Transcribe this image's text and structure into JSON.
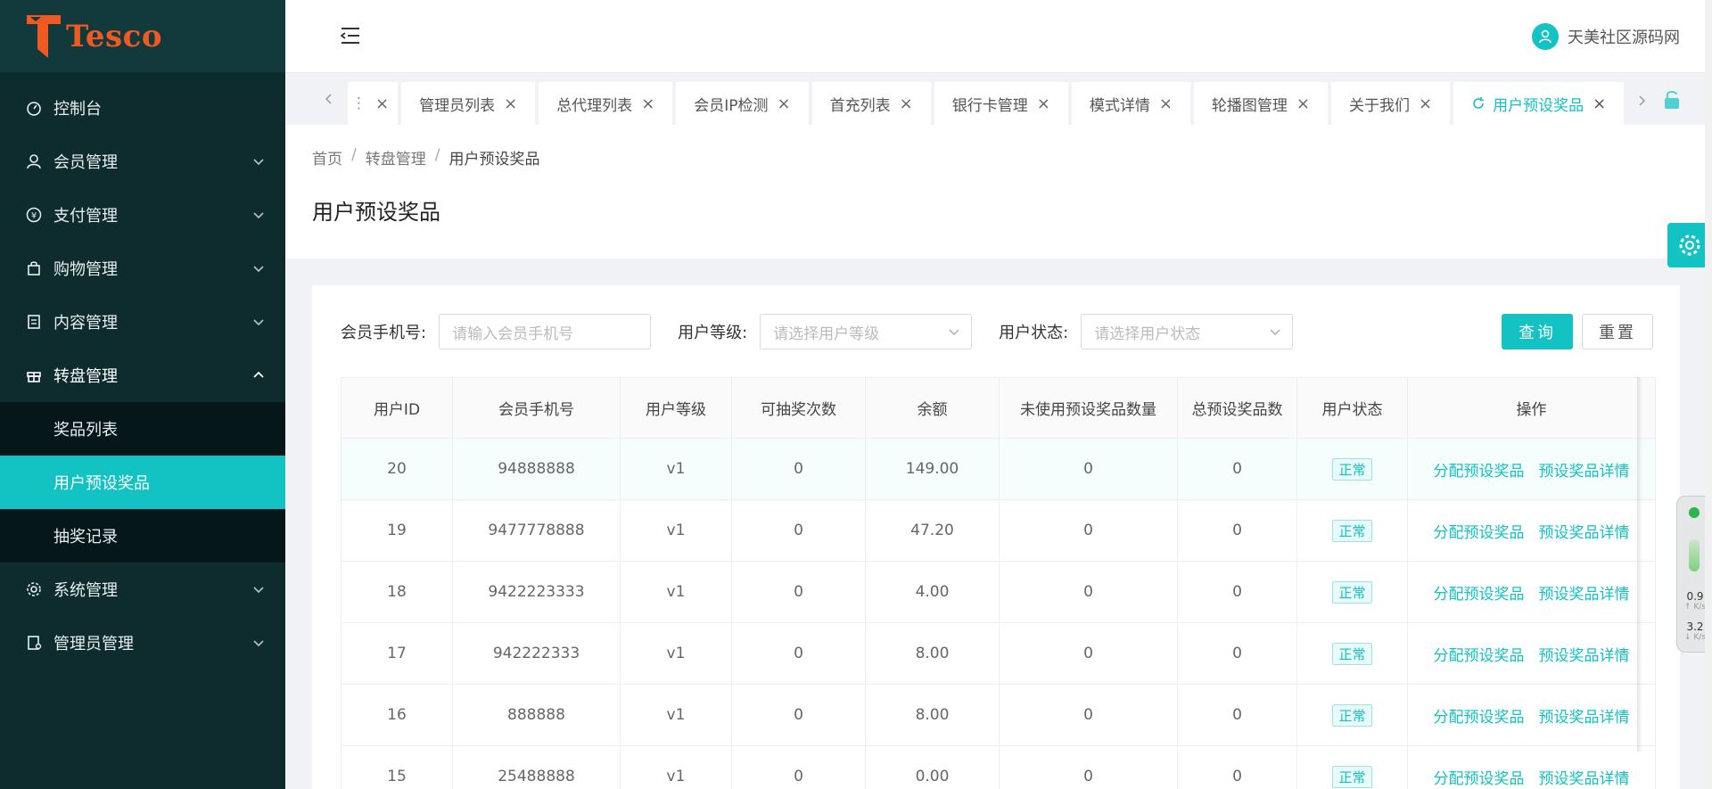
{
  "brand": {
    "name": "Tesco"
  },
  "sidebar": {
    "items": [
      {
        "label": "控制台",
        "icon": "dashboard-icon"
      },
      {
        "label": "会员管理",
        "icon": "user-icon"
      },
      {
        "label": "支付管理",
        "icon": "yuan-icon"
      },
      {
        "label": "购物管理",
        "icon": "bag-icon"
      },
      {
        "label": "内容管理",
        "icon": "document-icon"
      },
      {
        "label": "转盘管理",
        "icon": "gift-icon"
      },
      {
        "label": "系统管理",
        "icon": "gear-icon"
      },
      {
        "label": "管理员管理",
        "icon": "admin-icon"
      }
    ],
    "submenu": [
      {
        "label": "奖品列表"
      },
      {
        "label": "用户预设奖品"
      },
      {
        "label": "抽奖记录"
      }
    ]
  },
  "header": {
    "username": "天美社区源码网"
  },
  "tabs": [
    {
      "label": ""
    },
    {
      "label": "管理员列表"
    },
    {
      "label": "总代理列表"
    },
    {
      "label": "会员IP检测"
    },
    {
      "label": "首充列表"
    },
    {
      "label": "银行卡管理"
    },
    {
      "label": "模式详情"
    },
    {
      "label": "轮播图管理"
    },
    {
      "label": "关于我们"
    },
    {
      "label": "用户预设奖品"
    }
  ],
  "breadcrumb": {
    "home": "首页",
    "parent": "转盘管理",
    "current": "用户预设奖品"
  },
  "page": {
    "title": "用户预设奖品"
  },
  "filters": {
    "phone_label": "会员手机号:",
    "phone_placeholder": "请输入会员手机号",
    "level_label": "用户等级:",
    "level_placeholder": "请选择用户等级",
    "status_label": "用户状态:",
    "status_placeholder": "请选择用户状态",
    "query_label": "查询",
    "reset_label": "重置"
  },
  "table": {
    "columns": [
      "用户ID",
      "会员手机号",
      "用户等级",
      "可抽奖次数",
      "余额",
      "未使用预设奖品数量",
      "总预设奖品数",
      "用户状态",
      "操作"
    ],
    "rows": [
      {
        "id": "20",
        "phone": "94888888",
        "level": "v1",
        "draws": "0",
        "balance": "149.00",
        "unused": "0",
        "total": "0",
        "status": "正常"
      },
      {
        "id": "19",
        "phone": "9477778888",
        "level": "v1",
        "draws": "0",
        "balance": "47.20",
        "unused": "0",
        "total": "0",
        "status": "正常"
      },
      {
        "id": "18",
        "phone": "9422223333",
        "level": "v1",
        "draws": "0",
        "balance": "4.00",
        "unused": "0",
        "total": "0",
        "status": "正常"
      },
      {
        "id": "17",
        "phone": "942222333",
        "level": "v1",
        "draws": "0",
        "balance": "8.00",
        "unused": "0",
        "total": "0",
        "status": "正常"
      },
      {
        "id": "16",
        "phone": "888888",
        "level": "v1",
        "draws": "0",
        "balance": "8.00",
        "unused": "0",
        "total": "0",
        "status": "正常"
      },
      {
        "id": "15",
        "phone": "25488888",
        "level": "v1",
        "draws": "0",
        "balance": "0.00",
        "unused": "0",
        "total": "0",
        "status": "正常"
      }
    ],
    "op_assign": "分配预设奖品",
    "op_detail": "预设奖品详情"
  },
  "net_widget": {
    "up": "0.9",
    "down": "3.2",
    "unit": "K/s"
  },
  "colors": {
    "accent": "#13c2c2",
    "sidebar_bg": "#0e2b2e",
    "brand": "#f05a22"
  }
}
